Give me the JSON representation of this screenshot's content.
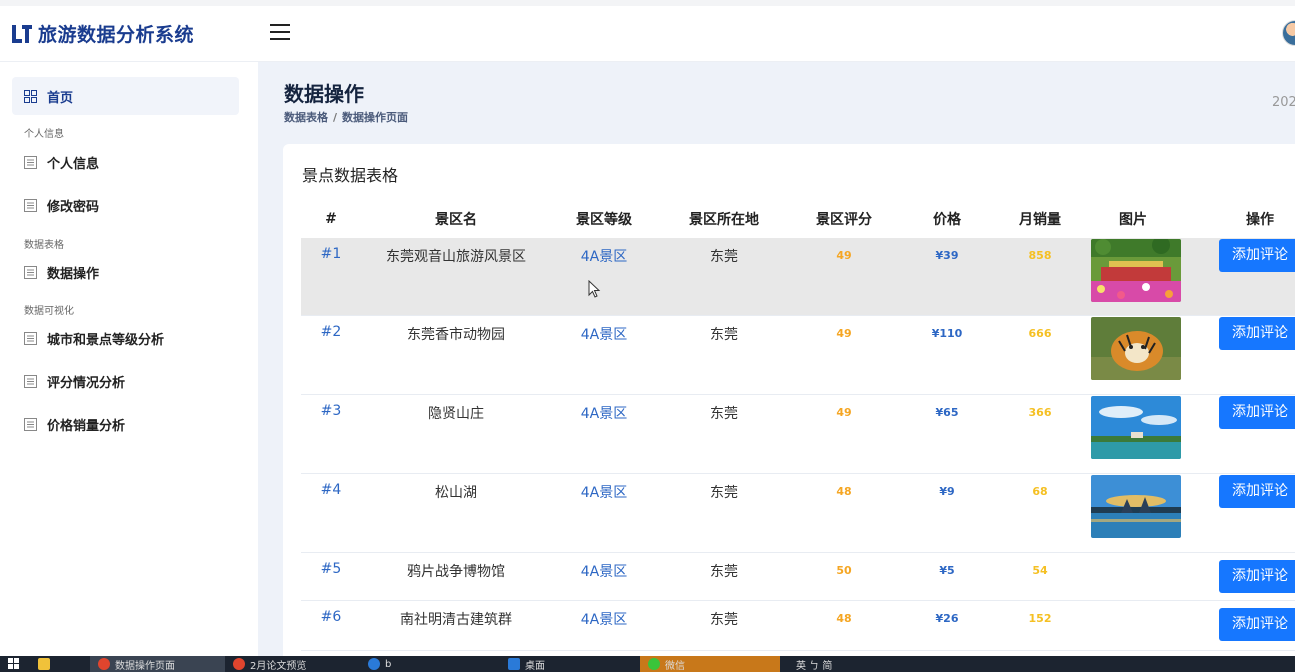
{
  "app": {
    "title": "旅游数据分析系统"
  },
  "sidebar": {
    "home": "首页",
    "sections": [
      {
        "title": "个人信息",
        "items": [
          "个人信息",
          "修改密码"
        ]
      },
      {
        "title": "数据表格",
        "items": [
          "数据操作"
        ]
      },
      {
        "title": "数据可视化",
        "items": [
          "城市和景点等级分析",
          "评分情况分析",
          "价格销量分析"
        ]
      }
    ]
  },
  "page": {
    "title": "数据操作",
    "breadcrumb": [
      "数据表格",
      "数据操作页面"
    ],
    "date_fragment": "202"
  },
  "table": {
    "title": "景点数据表格",
    "columns": [
      "#",
      "景区名",
      "景区等级",
      "景区所在地",
      "景区评分",
      "价格",
      "月销量",
      "图片",
      "操作"
    ],
    "action_label": "添加评论",
    "rows": [
      {
        "id": "#1",
        "name": "东莞观音山旅游风景区",
        "level": "4A景区",
        "city": "东莞",
        "score": "49",
        "price": "¥39",
        "sales": "858",
        "image": "flower-garden"
      },
      {
        "id": "#2",
        "name": "东莞香市动物园",
        "level": "4A景区",
        "city": "东莞",
        "score": "49",
        "price": "¥110",
        "sales": "666",
        "image": "tiger"
      },
      {
        "id": "#3",
        "name": "隐贤山庄",
        "level": "4A景区",
        "city": "东莞",
        "score": "49",
        "price": "¥65",
        "sales": "366",
        "image": "lake-sky"
      },
      {
        "id": "#4",
        "name": "松山湖",
        "level": "4A景区",
        "city": "东莞",
        "score": "48",
        "price": "¥9",
        "sales": "68",
        "image": "sunset-lake"
      },
      {
        "id": "#5",
        "name": "鸦片战争博物馆",
        "level": "4A景区",
        "city": "东莞",
        "score": "50",
        "price": "¥5",
        "sales": "54",
        "image": ""
      },
      {
        "id": "#6",
        "name": "南社明清古建筑群",
        "level": "4A景区",
        "city": "东莞",
        "score": "48",
        "price": "¥26",
        "sales": "152",
        "image": ""
      }
    ]
  },
  "taskbar": {
    "items": [
      "数据操作页面",
      "2月论文预览",
      "b",
      "桌面",
      "微信",
      "英 ㄅ 简"
    ]
  }
}
